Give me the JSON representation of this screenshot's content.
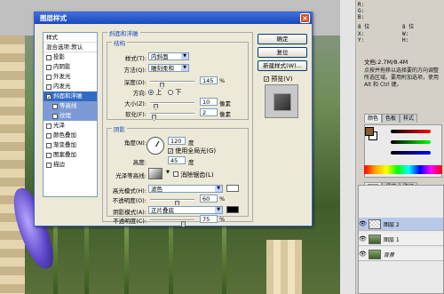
{
  "dialog": {
    "title": "图层样式",
    "style_list": [
      {
        "label": "样式",
        "type": "header"
      },
      {
        "label": "混合选项:默认",
        "type": "header"
      },
      {
        "label": "投影",
        "checked": false
      },
      {
        "label": "内阴影",
        "checked": false
      },
      {
        "label": "外发光",
        "checked": false
      },
      {
        "label": "内发光",
        "checked": false
      },
      {
        "label": "斜面和浮雕",
        "checked": true,
        "selected": true
      },
      {
        "label": "等高线",
        "checked": false,
        "sub": true
      },
      {
        "label": "纹理",
        "checked": false,
        "sub": true
      },
      {
        "label": "光泽",
        "checked": false
      },
      {
        "label": "颜色叠加",
        "checked": false
      },
      {
        "label": "渐变叠加",
        "checked": false
      },
      {
        "label": "图案叠加",
        "checked": false
      },
      {
        "label": "描边",
        "checked": false
      }
    ],
    "bevel_group": "斜面和浮雕",
    "structure": {
      "legend": "结构",
      "style_label": "样式(T):",
      "style_value": "内斜面",
      "technique_label": "方法(Q):",
      "technique_value": "雕刻柔和",
      "depth_label": "深度(D):",
      "depth_value": "145",
      "depth_unit": "%",
      "direction_label": "方向:",
      "direction_up": "上",
      "direction_down": "下",
      "size_label": "大小(Z):",
      "size_value": "10",
      "size_unit": "像素",
      "soften_label": "软化(F):",
      "soften_value": "2",
      "soften_unit": "像素"
    },
    "shading": {
      "legend": "阴影",
      "angle_label": "角度(N):",
      "angle_value": "120",
      "angle_unit": "度",
      "global_light_label": "使用全局光(G)",
      "altitude_label": "高度:",
      "altitude_value": "45",
      "altitude_unit": "度",
      "gloss_label": "光泽等高线:",
      "anti_alias_label": "消除锯齿(L)",
      "highlight_label": "高光模式(H):",
      "highlight_value": "滤色",
      "highlight_opacity_label": "不透明度(O):",
      "highlight_opacity_value": "60",
      "highlight_opacity_unit": "%",
      "shadow_label": "阴影模式(A):",
      "shadow_value": "正片叠底",
      "shadow_opacity_label": "不透明度(C):",
      "shadow_opacity_value": "75",
      "shadow_opacity_unit": "%"
    },
    "buttons": {
      "ok": "确定",
      "reset": "复位",
      "new_style": "新建样式(W)...",
      "preview": "预览(V)"
    },
    "colors": {
      "highlight": "#ffffff",
      "shadow": "#000000"
    }
  },
  "right_panel": {
    "info_labels": [
      "R:",
      "G:",
      "B:",
      "8 位",
      "X:",
      "Y:",
      "8 位",
      "W:",
      "H:"
    ],
    "doc_size": "文档:2.7M/8.4M",
    "hint": "点按并拖移以选择要的方向调整所选区域。要用附加选项，使用 Alt 和 Ctrl 键。",
    "color_tabs": [
      "颜色",
      "色板",
      "样式"
    ],
    "layer_tabs": [
      "图层",
      "通道",
      "路径"
    ],
    "layers": [
      {
        "name": "图层 2",
        "selected": true
      },
      {
        "name": "图层 1",
        "selected": false
      },
      {
        "name": "背景",
        "selected": false
      }
    ],
    "fg_color": "#8a5a2a"
  }
}
